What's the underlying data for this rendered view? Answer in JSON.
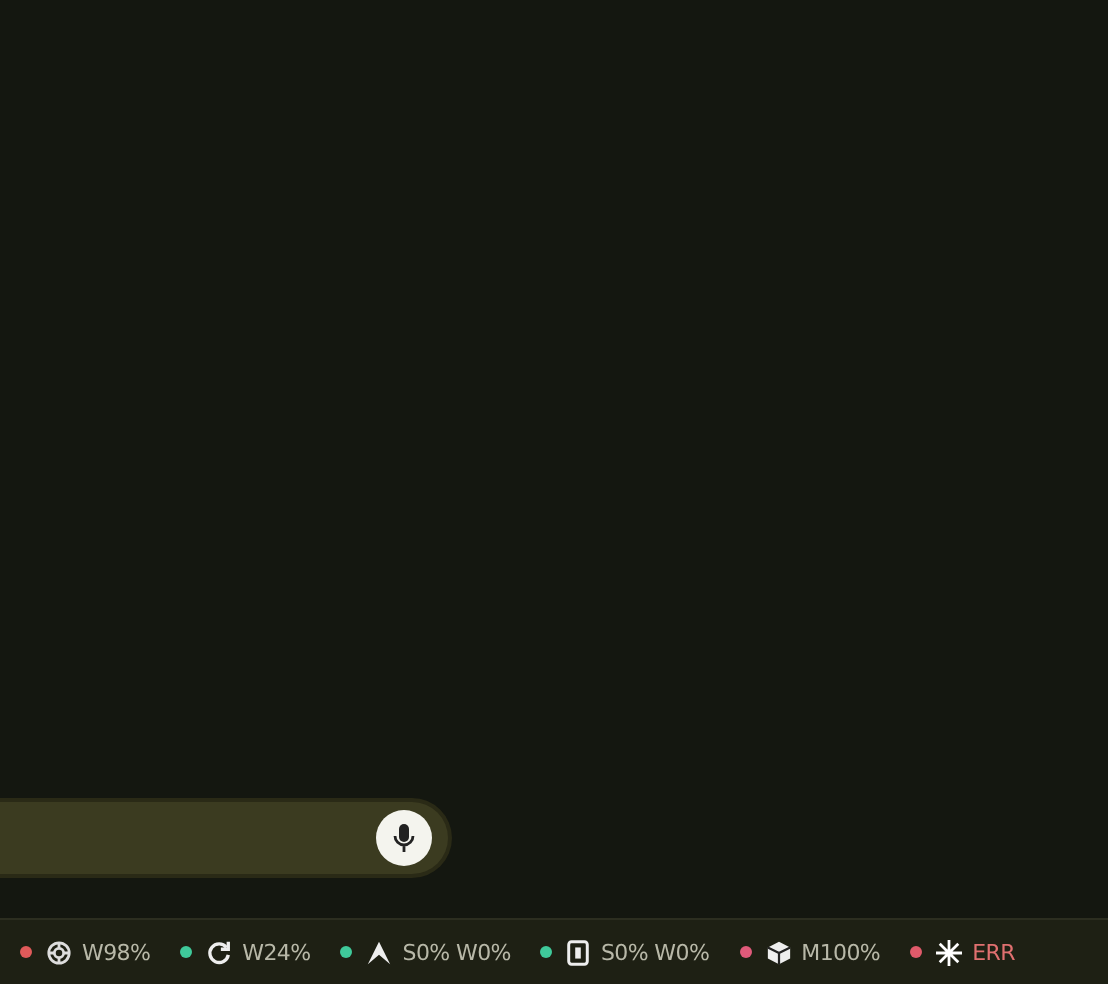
{
  "status_bar": {
    "items": [
      {
        "color": "#e05a5a",
        "kind": "knot",
        "text": "W98%",
        "error": false
      },
      {
        "color": "#3fc99a",
        "kind": "refresh",
        "text": "W24%",
        "error": false
      },
      {
        "color": "#3fc99a",
        "kind": "peak",
        "text": "S0% W0%",
        "error": false
      },
      {
        "color": "#3fc99a",
        "kind": "panel",
        "text": "S0% W0%",
        "error": false
      },
      {
        "color": "#e05a7a",
        "kind": "cube",
        "text": "M100%",
        "error": false
      },
      {
        "color": "#e05a6a",
        "kind": "burst",
        "text": "ERR",
        "error": true
      }
    ]
  }
}
